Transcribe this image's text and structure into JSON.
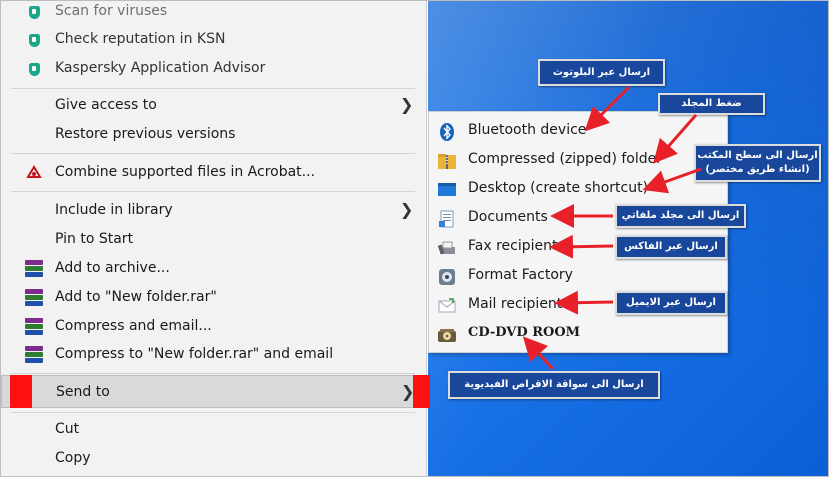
{
  "menu": {
    "items": [
      {
        "label": "Scan for viruses"
      },
      {
        "label": "Check reputation in KSN"
      },
      {
        "label": "Kaspersky Application Advisor"
      },
      {
        "label": "Give access to"
      },
      {
        "label": "Restore previous versions"
      },
      {
        "label": "Combine supported files in Acrobat..."
      },
      {
        "label": "Include in library"
      },
      {
        "label": "Pin to Start"
      },
      {
        "label": "Add to archive..."
      },
      {
        "label": "Add to \"New folder.rar\""
      },
      {
        "label": "Compress and email..."
      },
      {
        "label": "Compress to \"New folder.rar\" and email"
      },
      {
        "label": "Send to"
      },
      {
        "label": "Cut"
      },
      {
        "label": "Copy"
      }
    ],
    "submenu_arrow": "❯"
  },
  "send_to": {
    "items": [
      {
        "label": "Bluetooth device",
        "icon": "bluetooth-icon"
      },
      {
        "label": "Compressed (zipped) folder",
        "icon": "zip-folder-icon"
      },
      {
        "label": "Desktop (create shortcut)",
        "icon": "desktop-icon"
      },
      {
        "label": "Documents",
        "icon": "documents-icon"
      },
      {
        "label": "Fax recipient",
        "icon": "fax-icon"
      },
      {
        "label": "Format Factory",
        "icon": "format-factory-icon"
      },
      {
        "label": "Mail recipient",
        "icon": "mail-icon"
      },
      {
        "label": "CD-DVD ROOM",
        "icon": "cd-dvd-icon"
      }
    ]
  },
  "callouts": {
    "bluetooth": "ارسال عبر البلوتوث",
    "zip": "ضغط المجلد",
    "desktop_line1": "ارسال الى سطح المكتب",
    "desktop_line2": "(انشاء طريق مختصر)",
    "documents": "ارسال الى مجلد ملفاتي",
    "fax": "ارسال عبر الفاكس",
    "mail": "ارسال عبر الايميل",
    "cd": "ارسال الى سواقة الاقراص الفيديوية"
  },
  "colors": {
    "callout_bg": "#19479c",
    "arrow": "#e8202a",
    "highlight_bar": "#ff1010",
    "desktop": "#1a73e8"
  }
}
